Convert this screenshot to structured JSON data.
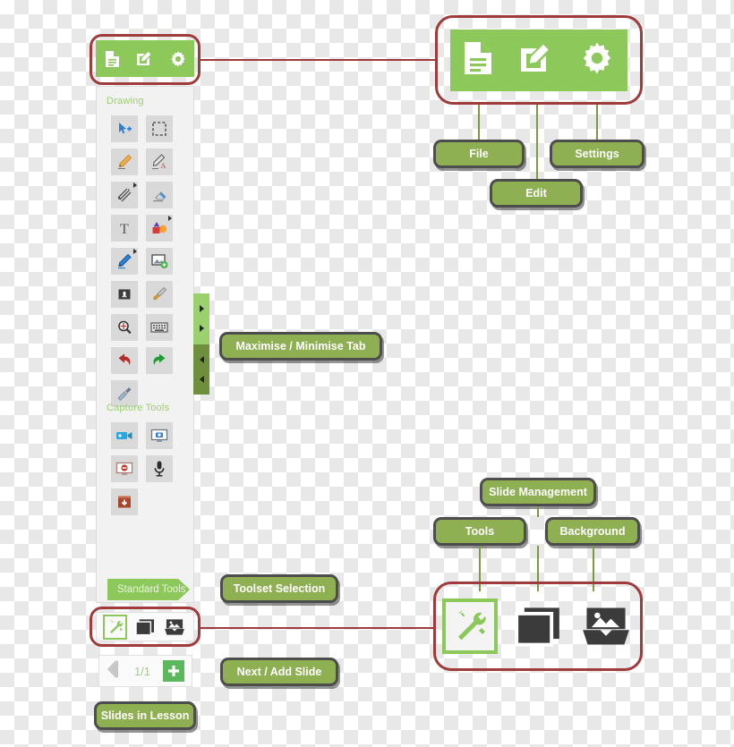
{
  "app": {
    "top_toolbar": {
      "name": "file-edit-settings-toolbar",
      "buttons": [
        {
          "icon": "document-icon",
          "label": "File"
        },
        {
          "icon": "edit-pencil-icon",
          "label": "Edit"
        },
        {
          "icon": "gear-icon",
          "label": "Settings"
        }
      ]
    },
    "drawing": {
      "section_title": "Drawing",
      "tools": [
        {
          "icon": "cursor-select-add-icon",
          "label": "Select"
        },
        {
          "icon": "marquee-select-icon",
          "label": "Area Select"
        },
        {
          "icon": "pencil-icon",
          "label": "Pencil"
        },
        {
          "icon": "pencil-annotate-icon",
          "label": "Annotate"
        },
        {
          "icon": "line-tool-icon",
          "label": "Lines"
        },
        {
          "icon": "eraser-icon",
          "label": "Eraser"
        },
        {
          "icon": "text-tool-icon",
          "label": "Text"
        },
        {
          "icon": "shapes-icon",
          "label": "Shapes"
        },
        {
          "icon": "pen-icon",
          "label": "Pen"
        },
        {
          "icon": "insert-image-icon",
          "label": "Insert Image"
        },
        {
          "icon": "stamp-icon",
          "label": "Stamp"
        },
        {
          "icon": "brush-icon",
          "label": "Brush"
        },
        {
          "icon": "magnifier-icon",
          "label": "Zoom"
        },
        {
          "icon": "keyboard-icon",
          "label": "Keyboard"
        },
        {
          "icon": "undo-icon",
          "label": "Undo"
        },
        {
          "icon": "redo-icon",
          "label": "Redo"
        },
        {
          "icon": "pointer-stick-icon",
          "label": "Pointer"
        }
      ]
    },
    "capture": {
      "section_title": "Capture Tools",
      "tools": [
        {
          "icon": "video-camera-icon",
          "label": "Record Video"
        },
        {
          "icon": "screenshot-icon",
          "label": "Screenshot"
        },
        {
          "icon": "stop-record-icon",
          "label": "Stop Recording"
        },
        {
          "icon": "microphone-icon",
          "label": "Record Audio"
        },
        {
          "icon": "export-box-icon",
          "label": "Export"
        }
      ]
    },
    "maximise_tab": {
      "name": "maximise-minimise-tab",
      "arrows": [
        "right",
        "right",
        "left",
        "left"
      ]
    },
    "standard_tools_banner": {
      "label": "Standard Tools"
    },
    "toolset_row": {
      "items": [
        {
          "icon": "tools-wrench-icon",
          "label": "Tools",
          "active": true
        },
        {
          "icon": "slide-management-icon",
          "label": "Slide Management",
          "active": false
        },
        {
          "icon": "background-image-icon",
          "label": "Background",
          "active": false
        }
      ]
    },
    "slide_nav": {
      "prev_icon": "chevron-left-icon",
      "counter": "1/1",
      "add_icon": "plus-icon"
    }
  },
  "callouts": {
    "file": "File",
    "edit": "Edit",
    "settings": "Settings",
    "maximise_minimise": "Maximise / Minimise Tab",
    "slide_management": "Slide Management",
    "tools": "Tools",
    "background": "Background",
    "toolset_selection": "Toolset Selection",
    "next_add_slide": "Next / Add Slide",
    "slides_in_lesson": "Slides in Lesson"
  },
  "colors": {
    "brand_green": "#8CC85A",
    "callout_green": "#8FB052",
    "callout_border": "#4D4D4D",
    "highlight_red": "#A03B3B",
    "leader_green": "#7D9A42",
    "tab_light": "#9CCF6E",
    "tab_dark": "#6F8F3F"
  }
}
